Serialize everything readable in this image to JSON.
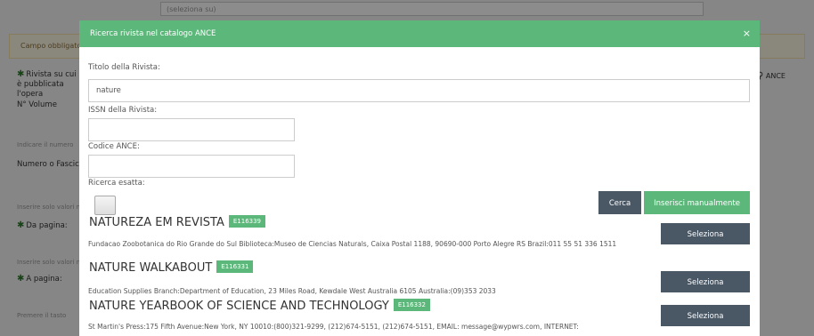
{
  "background": {
    "top_select_value": "(seleziona su)",
    "alert_text": "Campo obbligatorio",
    "labels": {
      "rivista": "Rivista su cui è pubblicata l'opera",
      "volume": "N° Volume",
      "indicare": "Indicare il numero",
      "numero": "Numero o Fascicolo",
      "inserire1": "Inserire solo valori numerici",
      "da_pagina": "Da pagina:",
      "inserire2": "Inserire solo valori numerici",
      "a_pagina": "A pagina:",
      "premere": "Premere il tasto"
    },
    "ance_button": "ANCE"
  },
  "modal": {
    "title": "Ricerca rivista nel catalogo ANCE",
    "close_symbol": "×",
    "fields": {
      "titolo_label": "Titolo della Rivista:",
      "titolo_value": "nature",
      "issn_label": "ISSN della Rivista:",
      "issn_value": "",
      "codice_label": "Codice ANCE:",
      "codice_value": "",
      "esatta_label": "Ricerca esatta:"
    },
    "buttons": {
      "cerca": "Cerca",
      "manual": "Inserisci manualmente",
      "seleziona": "Seleziona"
    },
    "results": [
      {
        "title": "NATUREZA EM REVISTA",
        "code": "E116339",
        "detail": "Fundacao Zoobotanica do Rio Grande do Sul Biblioteca:Museo de Ciencias Naturals, Caixa Postal 1188, 90690-000 Porto Alegre RS Brazil:011 55 51 336 1511"
      },
      {
        "title": "NATURE WALKABOUT",
        "code": "E116331",
        "detail": "Education Supplies Branch:Department of Education, 23 Miles Road, Kewdale West Australia 6105 Australia:(09)353 2033"
      },
      {
        "title": "NATURE YEARBOOK OF SCIENCE AND TECHNOLOGY",
        "code": "E116332",
        "detail": "St Martin's Press:175 Fifth Avenue:New York, NY 10010:(800)321-9299, (212)674-5151, (212)674-5151, EMAIL: message@wypwrs.com, INTERNET:"
      }
    ]
  },
  "colors": {
    "accent_green": "#5cb87a",
    "dark_button": "#4a5866"
  }
}
